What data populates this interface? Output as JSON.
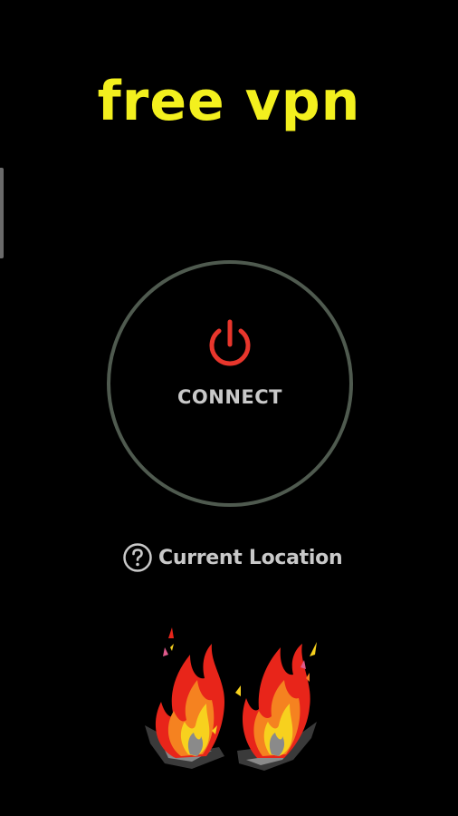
{
  "app": {
    "title": "free vpn"
  },
  "connect": {
    "label": "CONNECT",
    "icon": "power-icon",
    "icon_color": "#e8362c",
    "ring_color": "#4f5a4f"
  },
  "location": {
    "label": "Current Location",
    "icon": "question-circle-icon"
  },
  "colors": {
    "background": "#000000",
    "title": "#f3f01e",
    "text": "#c9c9c9"
  },
  "decoration": {
    "icon": "flames-icon"
  }
}
